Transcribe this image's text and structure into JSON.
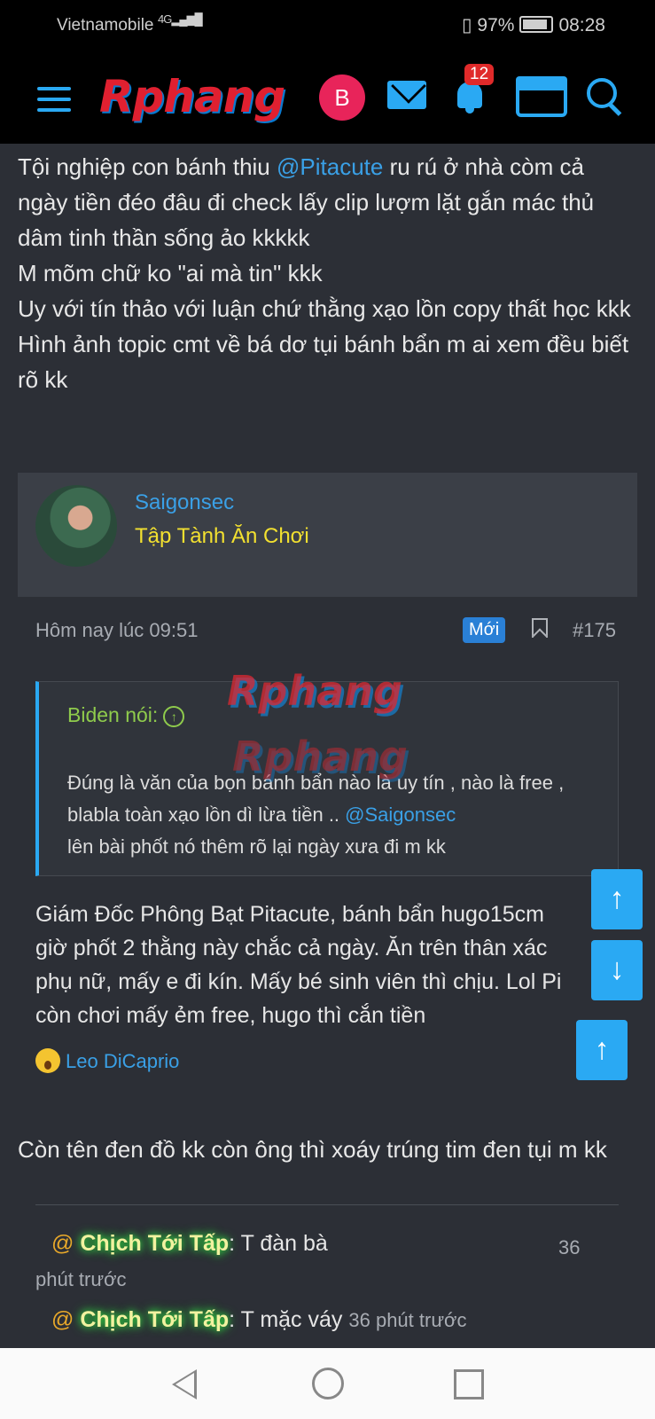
{
  "statusbar": {
    "carrier": "Vietnamobile",
    "network": "4G",
    "battery": "97%",
    "time": "08:28"
  },
  "header": {
    "logo": "Rphang",
    "avatar_letter": "B",
    "notif_count": "12"
  },
  "post_lines": [
    "Tội nghiệp con bánh thiu",
    "@Pitacute",
    "ru rú ở nhà còm cả ngày tiền đéo đâu đi check lấy clip lượm lặt gắn mác thủ dâm tinh thần sống ảo kkkkk",
    "M mõm chữ ko \"ai mà tin\" kkk",
    "Uy với tín thảo với luận chứ thằng xạo lồn copy thất học kkk",
    "Hình ảnh topic cmt về bá dơ tụi bánh bẩn m ai xem đều biết rõ kk"
  ],
  "user": {
    "name": "Saigonsec",
    "title": "Tập Tành Ăn Chơi"
  },
  "meta": {
    "time": "Hôm nay lúc 09:51",
    "badge": "Mới",
    "number": "#175"
  },
  "quote": {
    "author": "Biden nói:",
    "text_before": "Đúng là văn của bọn bánh bẩn nào là uy tín , nào là free , blabla toàn xạo lồn dì lừa tiền ..",
    "mention": "@Saigonsec",
    "text_after": "lên bài phốt nó thêm rõ lại ngày xưa đi m kk"
  },
  "watermark": "Rphang",
  "reply": {
    "lines": [
      "Giám Đốc Phông Bạt Pitacute, bánh bẩn hugo15cm",
      "giờ phốt 2 thằng này chắc cả ngày. Ăn trên thân xác",
      "phụ nữ, mấy e đi kín. Mấy bé sinh viên thì chịu. Lol Pi",
      "còn chơi mấy ẻm free, hugo thì cắn tiền"
    ]
  },
  "reaction": {
    "user": "Leo DiCaprio"
  },
  "comment": "Còn tên đen đồ kk còn ông thì xoáy trúng tim đen tụi m kk",
  "shoutbox": [
    {
      "at": "@",
      "name": "Chịch Tới Tấp",
      "text": ": T đàn bà",
      "time_a": "36",
      "time_b": "phút trước"
    },
    {
      "at": "@",
      "name": "Chịch Tới Tấp",
      "text": ": T mặc váy",
      "time": "36 phút trước"
    }
  ],
  "float_buttons": {
    "up": "↑",
    "down": "↓",
    "top": "↑"
  }
}
